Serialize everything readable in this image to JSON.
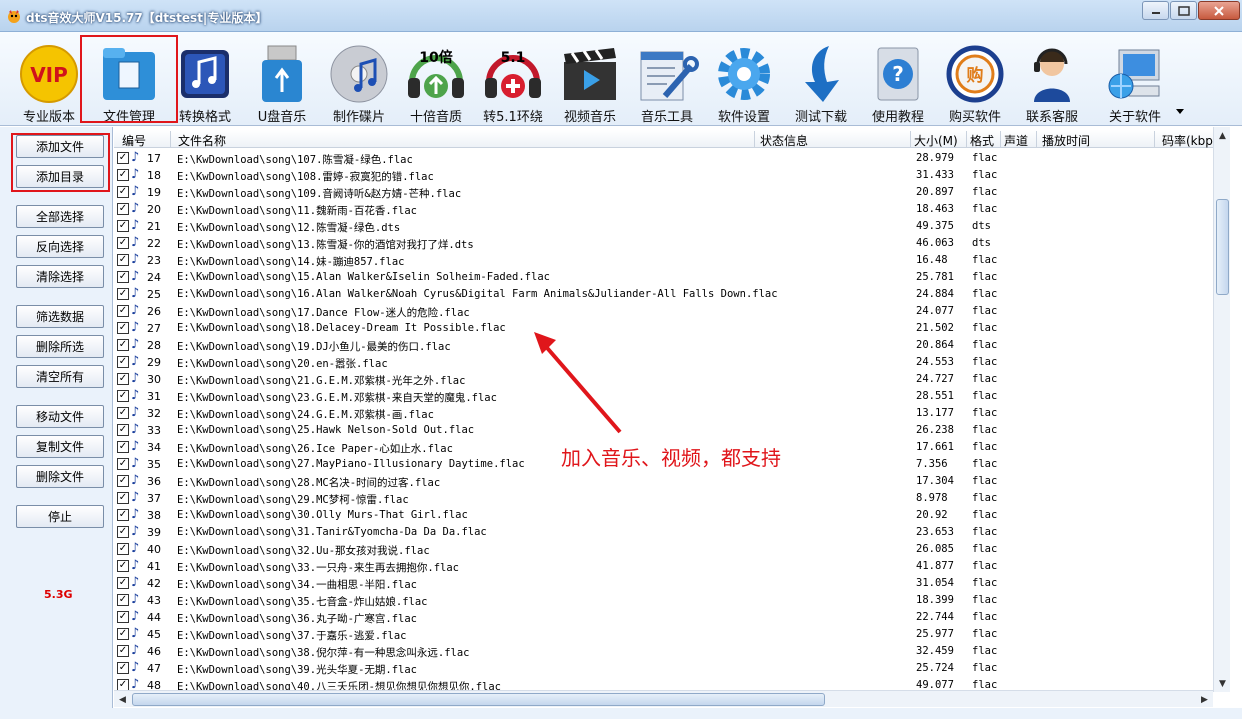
{
  "window": {
    "title": "dts音效大师V15.77【dtstest|专业版本】",
    "controls": [
      "minimize",
      "maximize",
      "close"
    ]
  },
  "toolbar": {
    "items": [
      {
        "label": "专业版本",
        "icon": "vip-icon"
      },
      {
        "label": "文件管理",
        "icon": "file-manager-icon",
        "active": true
      },
      {
        "label": "转换格式",
        "icon": "music-note-icon"
      },
      {
        "label": "U盘音乐",
        "icon": "usb-icon"
      },
      {
        "label": "制作碟片",
        "icon": "cd-music-icon"
      },
      {
        "label": "十倍音质",
        "icon": "headphones-10x-icon",
        "badge": "10倍"
      },
      {
        "label": "转5.1环绕",
        "icon": "headphones-51-icon",
        "badge": "5.1"
      },
      {
        "label": "视频音乐",
        "icon": "film-clapper-icon"
      },
      {
        "label": "音乐工具",
        "icon": "tools-icon"
      },
      {
        "label": "软件设置",
        "icon": "gear-icon"
      },
      {
        "label": "测试下载",
        "icon": "download-arrow-icon"
      },
      {
        "label": "使用教程",
        "icon": "help-icon"
      },
      {
        "label": "购买软件",
        "icon": "buy-icon",
        "badge": "购"
      },
      {
        "label": "联系客服",
        "icon": "support-agent-icon"
      },
      {
        "label": "关于软件",
        "icon": "computer-globe-icon"
      }
    ]
  },
  "sidebar": {
    "buttons": [
      "添加文件",
      "添加目录",
      "全部选择",
      "反向选择",
      "清除选择",
      "筛选数据",
      "删除所选",
      "清空所有",
      "移动文件",
      "复制文件",
      "删除文件",
      "停止"
    ],
    "size_label": "5.3G"
  },
  "table": {
    "headers": [
      "编号",
      "文件名称",
      "状态信息",
      "大小(M)",
      "格式",
      "声道",
      "播放时间",
      "码率(kbps"
    ],
    "rows": [
      {
        "num": "17",
        "path": "E:\\KwDownload\\song\\107.陈雪凝-绿色.flac",
        "size": "28.979",
        "fmt": "flac"
      },
      {
        "num": "18",
        "path": "E:\\KwDownload\\song\\108.雷婷-寂寞犯的错.flac",
        "size": "31.433",
        "fmt": "flac"
      },
      {
        "num": "19",
        "path": "E:\\KwDownload\\song\\109.音阙诗听&赵方婧-芒种.flac",
        "size": "20.897",
        "fmt": "flac"
      },
      {
        "num": "20",
        "path": "E:\\KwDownload\\song\\11.魏新雨-百花香.flac",
        "size": "18.463",
        "fmt": "flac"
      },
      {
        "num": "21",
        "path": "E:\\KwDownload\\song\\12.陈雪凝-绿色.dts",
        "size": "49.375",
        "fmt": "dts"
      },
      {
        "num": "22",
        "path": "E:\\KwDownload\\song\\13.陈雪凝-你的酒馆对我打了烊.dts",
        "size": "46.063",
        "fmt": "dts"
      },
      {
        "num": "23",
        "path": "E:\\KwDownload\\song\\14.妹-蹦迪857.flac",
        "size": "16.48",
        "fmt": "flac"
      },
      {
        "num": "24",
        "path": "E:\\KwDownload\\song\\15.Alan Walker&Iselin Solheim-Faded.flac",
        "size": "25.781",
        "fmt": "flac"
      },
      {
        "num": "25",
        "path": "E:\\KwDownload\\song\\16.Alan Walker&Noah Cyrus&Digital Farm Animals&Juliander-All Falls Down.flac",
        "size": "24.884",
        "fmt": "flac"
      },
      {
        "num": "26",
        "path": "E:\\KwDownload\\song\\17.Dance Flow-迷人的危险.flac",
        "size": "24.077",
        "fmt": "flac"
      },
      {
        "num": "27",
        "path": "E:\\KwDownload\\song\\18.Delacey-Dream It Possible.flac",
        "size": "21.502",
        "fmt": "flac"
      },
      {
        "num": "28",
        "path": "E:\\KwDownload\\song\\19.DJ小鱼儿-最美的伤口.flac",
        "size": "20.864",
        "fmt": "flac"
      },
      {
        "num": "29",
        "path": "E:\\KwDownload\\song\\20.en-嚣张.flac",
        "size": "24.553",
        "fmt": "flac"
      },
      {
        "num": "30",
        "path": "E:\\KwDownload\\song\\21.G.E.M.邓紫棋-光年之外.flac",
        "size": "24.727",
        "fmt": "flac"
      },
      {
        "num": "31",
        "path": "E:\\KwDownload\\song\\23.G.E.M.邓紫棋-来自天堂的魔鬼.flac",
        "size": "28.551",
        "fmt": "flac"
      },
      {
        "num": "32",
        "path": "E:\\KwDownload\\song\\24.G.E.M.邓紫棋-画.flac",
        "size": "13.177",
        "fmt": "flac"
      },
      {
        "num": "33",
        "path": "E:\\KwDownload\\song\\25.Hawk Nelson-Sold Out.flac",
        "size": "26.238",
        "fmt": "flac"
      },
      {
        "num": "34",
        "path": "E:\\KwDownload\\song\\26.Ice Paper-心如止水.flac",
        "size": "17.661",
        "fmt": "flac"
      },
      {
        "num": "35",
        "path": "E:\\KwDownload\\song\\27.MayPiano-Illusionary Daytime.flac",
        "size": "7.356",
        "fmt": "flac"
      },
      {
        "num": "36",
        "path": "E:\\KwDownload\\song\\28.MC名决-时间的过客.flac",
        "size": "17.304",
        "fmt": "flac"
      },
      {
        "num": "37",
        "path": "E:\\KwDownload\\song\\29.MC梦柯-惊雷.flac",
        "size": "8.978",
        "fmt": "flac"
      },
      {
        "num": "38",
        "path": "E:\\KwDownload\\song\\30.Olly Murs-That Girl.flac",
        "size": "20.92",
        "fmt": "flac"
      },
      {
        "num": "39",
        "path": "E:\\KwDownload\\song\\31.Tanir&Tyomcha-Da Da Da.flac",
        "size": "23.653",
        "fmt": "flac"
      },
      {
        "num": "40",
        "path": "E:\\KwDownload\\song\\32.Uu-那女孩对我说.flac",
        "size": "26.085",
        "fmt": "flac"
      },
      {
        "num": "41",
        "path": "E:\\KwDownload\\song\\33.一只舟-来生再去拥抱你.flac",
        "size": "41.877",
        "fmt": "flac"
      },
      {
        "num": "42",
        "path": "E:\\KwDownload\\song\\34.一曲相思-半阳.flac",
        "size": "31.054",
        "fmt": "flac"
      },
      {
        "num": "43",
        "path": "E:\\KwDownload\\song\\35.七音盒-炸山姑娘.flac",
        "size": "18.399",
        "fmt": "flac"
      },
      {
        "num": "44",
        "path": "E:\\KwDownload\\song\\36.丸子呦-广寒宫.flac",
        "size": "22.744",
        "fmt": "flac"
      },
      {
        "num": "45",
        "path": "E:\\KwDownload\\song\\37.于嘉乐-逃爱.flac",
        "size": "25.977",
        "fmt": "flac"
      },
      {
        "num": "46",
        "path": "E:\\KwDownload\\song\\38.倪尔萍-有一种思念叫永远.flac",
        "size": "32.459",
        "fmt": "flac"
      },
      {
        "num": "47",
        "path": "E:\\KwDownload\\song\\39.光头华夏-无期.flac",
        "size": "25.724",
        "fmt": "flac"
      },
      {
        "num": "48",
        "path": "E:\\KwDownload\\song\\40.八三夭乐团-想见你想见你想见你.flac",
        "size": "49.077",
        "fmt": "flac"
      }
    ]
  },
  "annotation": {
    "text": "加入音乐、视频，都支持",
    "color": "#e0161b"
  }
}
